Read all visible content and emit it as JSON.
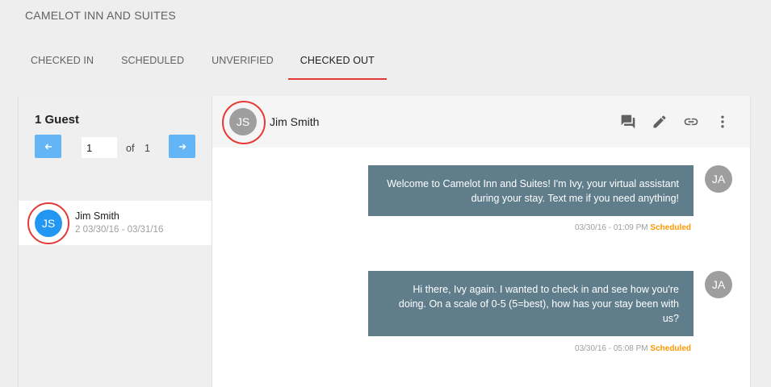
{
  "header": {
    "title": "CAMELOT INN AND SUITES"
  },
  "tabs": [
    {
      "label": "CHECKED IN"
    },
    {
      "label": "SCHEDULED"
    },
    {
      "label": "UNVERIFIED"
    },
    {
      "label": "CHECKED OUT",
      "active": true
    }
  ],
  "sidebar": {
    "guest_count": "1 Guest",
    "pager": {
      "page_value": "1",
      "of_label": "of",
      "total": "1"
    },
    "guests": [
      {
        "initials": "JS",
        "name": "Jim Smith",
        "details": "2 03/30/16 - 03/31/16"
      }
    ]
  },
  "chat": {
    "header": {
      "initials": "JS",
      "name": "Jim Smith"
    },
    "icons": [
      "chat-icon",
      "edit-icon",
      "link-icon",
      "more-vert-icon"
    ],
    "messages": [
      {
        "avatar": "JA",
        "text": "Welcome to Camelot Inn and Suites! I'm Ivy, your virtual assistant during your stay. Text me if you need anything!",
        "timestamp": "03/30/16 - 01:09 PM",
        "status": "Scheduled"
      },
      {
        "avatar": "JA",
        "text": "Hi there, Ivy again. I wanted to check in and see how you're doing. On a scale of 0-5 (5=best), how has your stay been with us?",
        "timestamp": "03/30/16 - 05:08 PM",
        "status": "Scheduled"
      }
    ]
  },
  "colors": {
    "accent_red": "#e53935",
    "pager_blue": "#64b5f6",
    "avatar_blue": "#2196f3",
    "message_bg": "#607d8b",
    "status_orange": "#ff9800"
  }
}
